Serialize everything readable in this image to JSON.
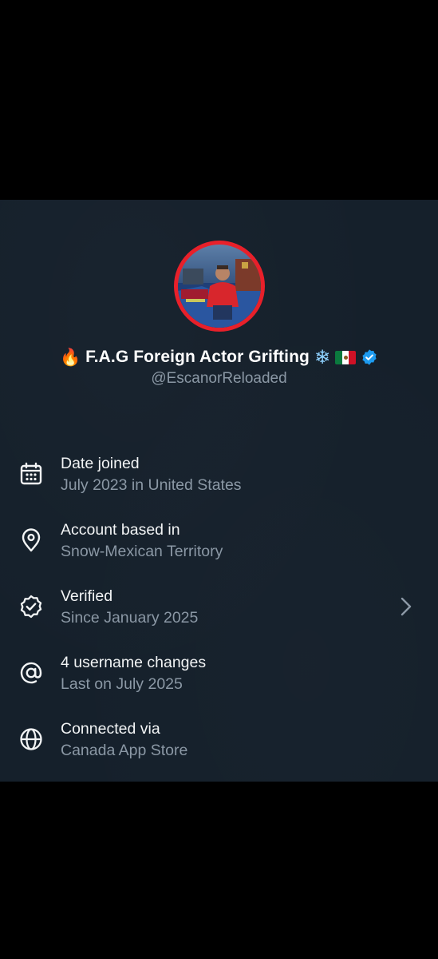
{
  "profile": {
    "display_name": "F.A.G Foreign Actor Grifting",
    "handle": "@EscanorReloaded",
    "name_emojis": [
      "fire",
      "snowflake",
      "flag-mexico"
    ],
    "verified_badge_color": "#1d9bf0"
  },
  "about": {
    "items": [
      {
        "icon": "calendar-icon",
        "title": "Date joined",
        "subtitle": "July 2023 in United States"
      },
      {
        "icon": "location-pin-icon",
        "title": "Account based in",
        "subtitle": "Snow-Mexican Territory"
      },
      {
        "icon": "verified-check-icon",
        "title": "Verified",
        "subtitle": "Since January 2025",
        "has_chevron": true
      },
      {
        "icon": "at-sign-icon",
        "title": "4 username changes",
        "subtitle": "Last on July 2025"
      },
      {
        "icon": "globe-icon",
        "title": "Connected via",
        "subtitle": "Canada App Store"
      }
    ]
  },
  "colors": {
    "card_background": "#15202b",
    "primary_text": "#f2f4f5",
    "secondary_text": "#8b98a5",
    "avatar_ring": "#e8202a"
  }
}
